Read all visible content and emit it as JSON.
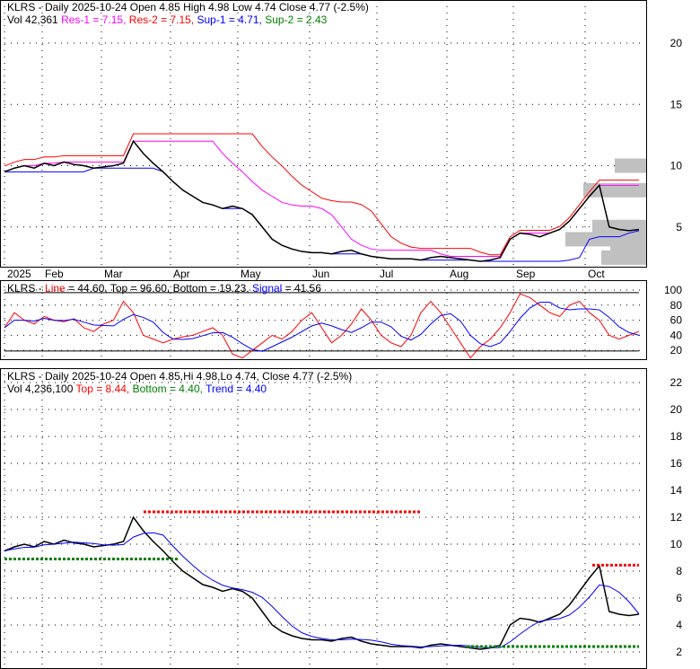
{
  "chart_data": [
    {
      "type": "line",
      "title": "KLRS - Daily 2025-10-24 Open 4.85  High 4.98  Low 4.74  Close 4.77 (-2.5%)",
      "legend": {
        "vol": "Vol 42,361",
        "res1": "Res-1 = 7.15,",
        "res2": "Res-2 = 7.15,",
        "sup1": "Sup-1 = 4.71,",
        "sup2": "Sup-2 = 2.43"
      },
      "yticks": [
        "20",
        "15",
        "10",
        "5"
      ],
      "ytick_values": [
        20,
        15,
        10,
        5
      ],
      "ylim": [
        0,
        22.5
      ],
      "xticks": [
        "2025",
        "Feb",
        "Mar",
        "Apr",
        "May",
        "Jun",
        "Jul",
        "Aug",
        "Sep",
        "Oct"
      ],
      "close": [
        9.5,
        9.8,
        10,
        9.8,
        10.2,
        10,
        10.3,
        10.1,
        10,
        9.8,
        9.9,
        10,
        10.2,
        12,
        11,
        10.2,
        9.5,
        8.7,
        8,
        7.5,
        7,
        6.8,
        6.5,
        6.7,
        6.5,
        6,
        5,
        4,
        3.5,
        3.2,
        3,
        2.9,
        2.9,
        2.8,
        3.0,
        3.1,
        2.8,
        2.6,
        2.5,
        2.4,
        2.4,
        2.4,
        2.3,
        2.5,
        2.6,
        2.5,
        2.4,
        2.3,
        2.2,
        2.3,
        2.5,
        4.0,
        4.5,
        4.4,
        4.2,
        4.5,
        4.8,
        5.5,
        6.5,
        7.5,
        8.4,
        5,
        4.8,
        4.7,
        4.8
      ]
    },
    {
      "type": "line",
      "title_prefix": "KLRS - ",
      "line_label": "Line",
      "line_value": " = 44.60, Top = 96.60, Bottom = 19.23, ",
      "signal_label": "Signal",
      "signal_value": " = 41.56",
      "yticks": [
        "100",
        "80",
        "60",
        "40",
        "20"
      ],
      "ytick_values": [
        100,
        80,
        60,
        40,
        20
      ],
      "ylim": [
        0,
        100
      ],
      "line": [
        50,
        70,
        60,
        55,
        65,
        60,
        58,
        62,
        50,
        45,
        55,
        60,
        85,
        70,
        40,
        35,
        30,
        35,
        38,
        40,
        45,
        50,
        40,
        15,
        10,
        20,
        30,
        40,
        35,
        45,
        60,
        70,
        50,
        30,
        40,
        55,
        75,
        60,
        40,
        30,
        25,
        40,
        70,
        85,
        70,
        50,
        30,
        10,
        25,
        35,
        50,
        70,
        95,
        90,
        80,
        70,
        65,
        80,
        85,
        70,
        60,
        40,
        35,
        40,
        45
      ],
      "top": 96.6,
      "bottom": 19.23
    },
    {
      "type": "line",
      "title": "KLRS - Daily 2025-10-24 Open 4.85,Hi 4.98,Lo 4.74, Close 4.77 (-2.5%)",
      "legend": {
        "vol": "Vol 4,236,100",
        "top": "Top = 8.44,",
        "bottom": "Bottom = 4.40,",
        "trend": "Trend = 4.40"
      },
      "yticks": [
        "22",
        "20",
        "18",
        "16",
        "14",
        "12",
        "10",
        "8",
        "6",
        "4",
        "2"
      ],
      "ytick_values": [
        22,
        20,
        18,
        16,
        14,
        12,
        10,
        8,
        6,
        4,
        2
      ],
      "ylim": [
        0,
        22
      ]
    }
  ],
  "colors": {
    "res1": "#ff00ff",
    "res2": "#ff0000",
    "sup1": "#0000ff",
    "sup2": "#008000",
    "up": "#008000",
    "down": "#ff0000"
  }
}
